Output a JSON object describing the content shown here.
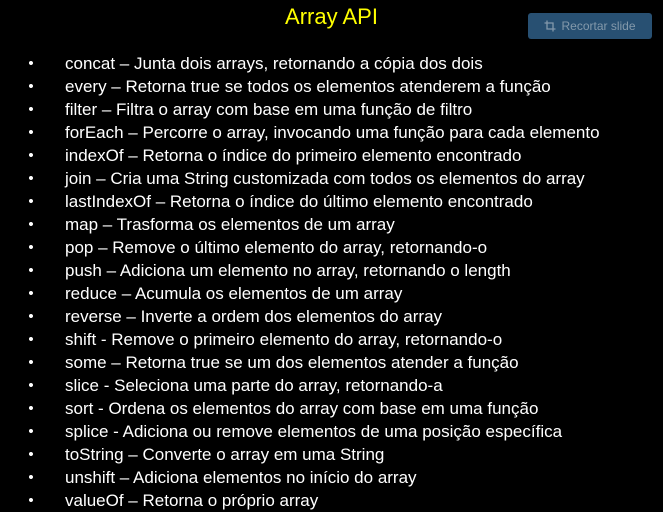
{
  "slide": {
    "title": "Array API",
    "clip_button": {
      "label": "Recortar slide",
      "icon": "clip-icon"
    },
    "bullet_symbol": "•",
    "items": [
      "concat – Junta dois arrays, retornando a cópia dos dois",
      "every – Retorna true se todos os elementos atenderem a função",
      "filter – Filtra o array com base em uma função de filtro",
      "forEach – Percorre o array, invocando uma função para cada elemento",
      "indexOf – Retorna o índice do primeiro elemento encontrado",
      "join – Cria uma String customizada com todos os elementos do array",
      "lastIndexOf – Retorna o índice do último elemento encontrado",
      "map – Trasforma os elementos de um array",
      "pop – Remove o último elemento do array, retornando-o",
      "push – Adiciona um elemento no array, retornando o length",
      "reduce – Acumula os elementos de um array",
      "reverse – Inverte a ordem dos elementos do array",
      "shift - Remove o primeiro elemento do array, retornando-o",
      "some – Retorna true se um dos elementos atender a função",
      "slice - Seleciona uma parte do array, retornando-a",
      "sort - Ordena os elementos do array com base em uma função",
      "splice - Adiciona ou remove elementos de uma posição específica",
      "toString – Converte o array em uma String",
      "unshift – Adiciona elementos no início do array",
      "valueOf – Retorna o próprio array"
    ],
    "colors": {
      "background": "#000000",
      "title": "#ffff00",
      "text": "#ffffff",
      "clip_button_bg": "#2f5e86"
    }
  }
}
